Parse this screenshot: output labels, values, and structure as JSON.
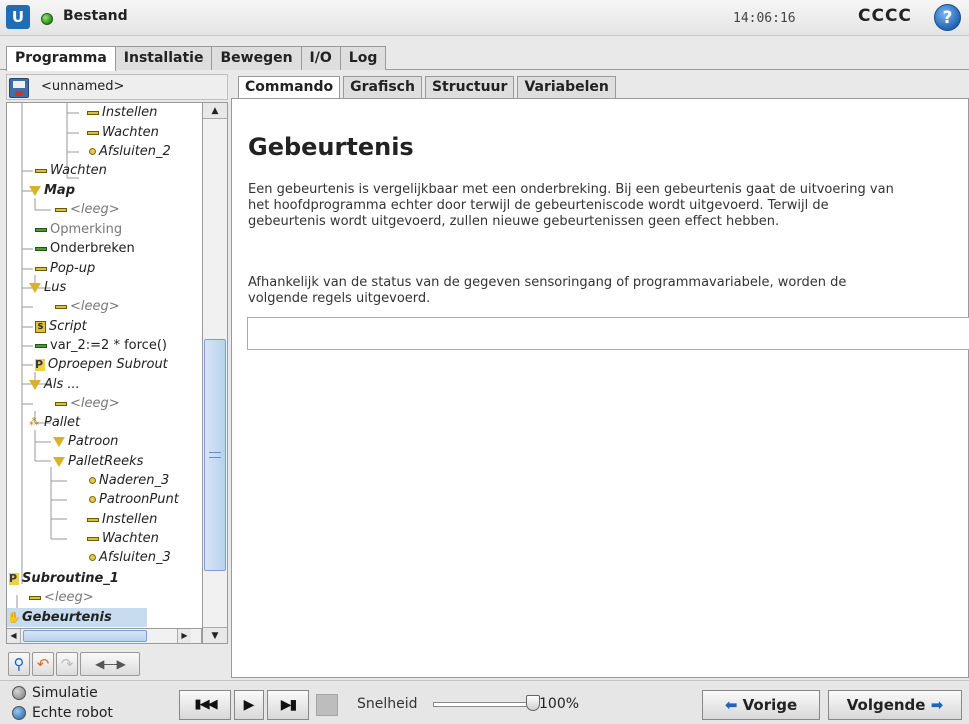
{
  "app": {
    "title": "Bestand",
    "clock": "14:06:16",
    "robot": "CCCC",
    "help": "?"
  },
  "main_tabs": [
    "Programma",
    "Installatie",
    "Bewegen",
    "I/O",
    "Log"
  ],
  "program": {
    "name": "<unnamed>"
  },
  "tree": [
    {
      "label": "Instellen"
    },
    {
      "label": "Wachten"
    },
    {
      "label": "Afsluiten_2"
    },
    {
      "label": "Wachten"
    },
    {
      "label": "Map"
    },
    {
      "label": "<leeg>"
    },
    {
      "label": "Opmerking"
    },
    {
      "label": "Onderbreken"
    },
    {
      "label": "Pop-up"
    },
    {
      "label": "Lus"
    },
    {
      "label": "<leeg>"
    },
    {
      "label": "Script"
    },
    {
      "label": "var_2:=2 * force()"
    },
    {
      "label": "Oproepen Subrout"
    },
    {
      "label": "Als ..."
    },
    {
      "label": "<leeg>"
    },
    {
      "label": "Pallet"
    },
    {
      "label": "Patroon"
    },
    {
      "label": "PalletReeks"
    },
    {
      "label": "Naderen_3"
    },
    {
      "label": "PatroonPunt"
    },
    {
      "label": "Instellen"
    },
    {
      "label": "Wachten"
    },
    {
      "label": "Afsluiten_3"
    },
    {
      "label": "Subroutine_1"
    },
    {
      "label": "<leeg>"
    },
    {
      "label": "Gebeurtenis"
    }
  ],
  "sub_tabs": [
    "Commando",
    "Grafisch",
    "Structuur",
    "Variabelen"
  ],
  "content": {
    "heading": "Gebeurtenis",
    "p1": "Een gebeurtenis is vergelijkbaar met een onderbreking. Bij een gebeurtenis gaat de uitvoering van het hoofdprogramma echter door terwijl de gebeurteniscode wordt uitgevoerd. Terwijl de gebeurtenis wordt uitgevoerd, zullen nieuwe gebeurtenissen geen effect hebben.",
    "p2": "Afhankelijk van de status van de gegeven sensoringang of programmavariabele, worden de volgende regels uitgevoerd.",
    "condition_value": ""
  },
  "bottom": {
    "mode_sim": "Simulatie",
    "mode_real": "Echte robot",
    "speed_label": "Snelheid",
    "speed_value": "100%",
    "prev": "Vorige",
    "next": "Volgende"
  },
  "colors": {
    "accent": "#1f64b6",
    "selected": "#c8dcf0"
  }
}
